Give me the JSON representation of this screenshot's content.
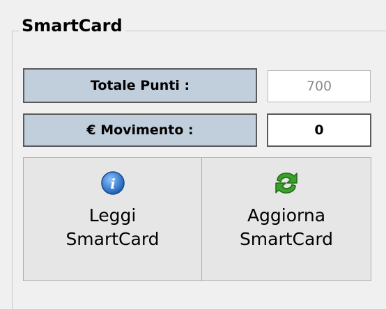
{
  "group": {
    "title": "SmartCard"
  },
  "fields": {
    "totale_punti": {
      "label": "Totale Punti :",
      "value": "700"
    },
    "movimento": {
      "label": "€ Movimento :",
      "value": "0"
    }
  },
  "buttons": {
    "leggi": {
      "line1": "Leggi",
      "line2": "SmartCard",
      "icon": "info-icon"
    },
    "aggiorna": {
      "line1": "Aggiorna",
      "line2": "SmartCard",
      "icon": "refresh-icon"
    }
  },
  "colors": {
    "label_bg": "#c1cfdc",
    "info_blue": "#2f7fd8",
    "refresh_green": "#3aa12a"
  }
}
